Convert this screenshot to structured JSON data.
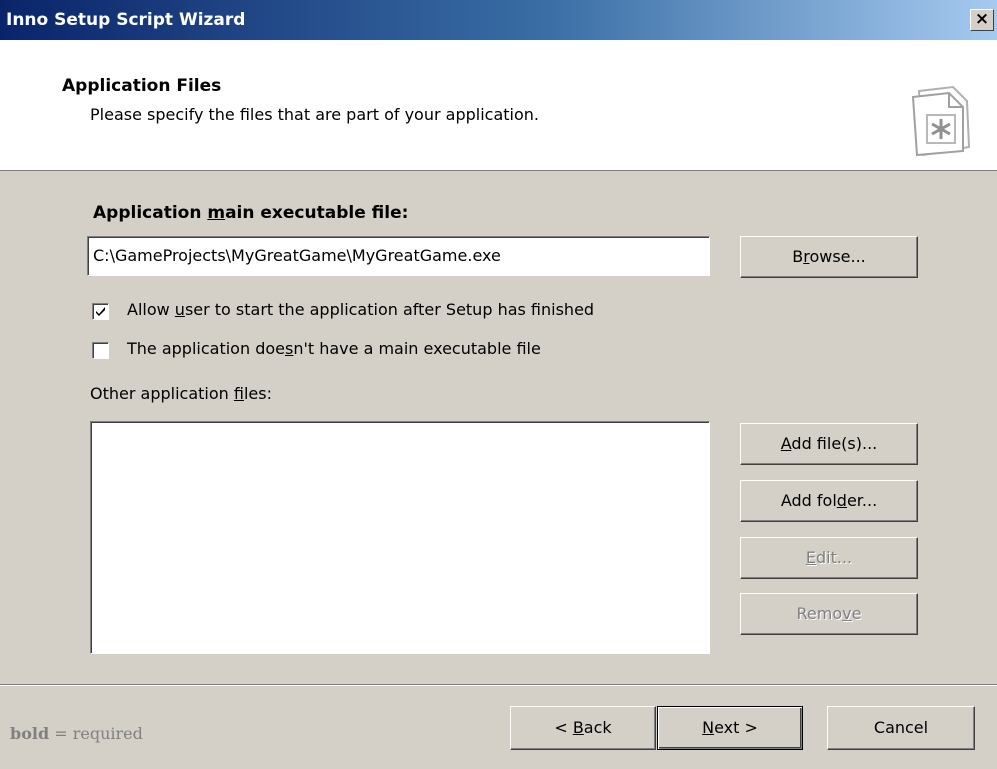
{
  "window": {
    "title": "Inno Setup Script Wizard",
    "close_label": "×"
  },
  "header": {
    "title": "Application Files",
    "subtitle": "Please specify the files that are part of your application."
  },
  "main_exe": {
    "label_pre": "Application ",
    "label_u": "m",
    "label_post": "ain executable file:",
    "value": "C:\\GameProjects\\MyGreatGame\\MyGreatGame.exe",
    "browse": {
      "pre": "B",
      "u": "r",
      "post": "owse..."
    }
  },
  "options": {
    "allow_start": {
      "pre": "Allow ",
      "u": "u",
      "post": "ser to start the application after Setup has finished",
      "checked": true
    },
    "no_main_exe": {
      "pre": "The application doe",
      "u": "s",
      "post": "n't have a main executable file",
      "checked": false
    }
  },
  "other_files": {
    "label_pre": "Other application ",
    "label_u": "f",
    "label_post": "iles:",
    "items": []
  },
  "side_buttons": {
    "add_files": {
      "pre": "",
      "u": "A",
      "post": "dd file(s)...",
      "enabled": true
    },
    "add_folder": {
      "pre": "Add fol",
      "u": "d",
      "post": "er...",
      "enabled": true
    },
    "edit": {
      "pre": "",
      "u": "E",
      "post": "dit...",
      "enabled": false
    },
    "remove": {
      "pre": "Remo",
      "u": "v",
      "post": "e",
      "enabled": false
    }
  },
  "footer": {
    "note_bold": "bold",
    "note_rest": " = required",
    "back": {
      "pre": "< ",
      "u": "B",
      "post": "ack"
    },
    "next": {
      "pre": "",
      "u": "N",
      "post": "ext >"
    },
    "cancel": "Cancel"
  },
  "colors": {
    "face": "#d4d0c8",
    "title_start": "#0a246a",
    "title_end": "#a6caf0",
    "disabled_text": "#808080"
  }
}
